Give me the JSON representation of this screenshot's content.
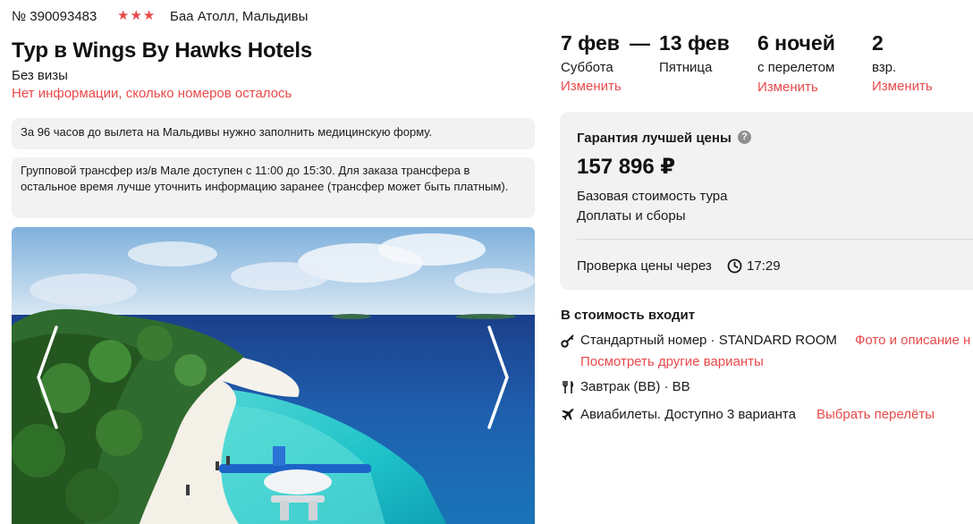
{
  "header": {
    "tour_number": "№ 390093483",
    "stars": "★★★",
    "location": "Баа Атолл, Мальдивы",
    "title": "Тур в Wings By Hawks Hotels",
    "visa": "Без визы",
    "rooms_left": "Нет информации, сколько номеров осталось"
  },
  "notices": [
    "За 96 часов до вылета на Мальдивы нужно заполнить медицинскую форму.",
    "Групповой трансфер из/в Мале доступен с 11:00 до 15:30. Для заказа трансфера в остальное время лучше уточнить информацию заранее (трансфер может быть платным)."
  ],
  "trip": {
    "date_from": "7 фев",
    "dash": "—",
    "date_to": "13 фев",
    "day_from": "Суббота",
    "day_to": "Пятница",
    "nights": "6 ночей",
    "nights_sub": "с перелетом",
    "guests": "2",
    "guests_sub": "взр.",
    "change_label": "Изменить"
  },
  "price_card": {
    "guarantee": "Гарантия лучшей цены",
    "price": "157 896 ₽",
    "base_cost": "Базовая стоимость тура",
    "fees": "Доплаты и сборы",
    "check_text": "Проверка цены через",
    "check_time": "17:29"
  },
  "included": {
    "title": "В стоимость входит",
    "room": "Стандартный номер · STANDARD ROOM",
    "room_link": "Фото и описание н",
    "other_variants": "Посмотреть другие варианты",
    "meal": "Завтрак (BB) · BB",
    "flights": "Авиабилеты. Доступно 3 варианта",
    "flights_link": "Выбрать перелёты"
  },
  "icons": {
    "help": "?",
    "clock": "clock-icon",
    "key": "key-icon",
    "fork": "fork-knife-icon",
    "plane": "airplane-icon"
  },
  "colors": {
    "accent": "#e8494a",
    "card_bg": "#f2f2f2",
    "text": "#1a1a1a"
  }
}
